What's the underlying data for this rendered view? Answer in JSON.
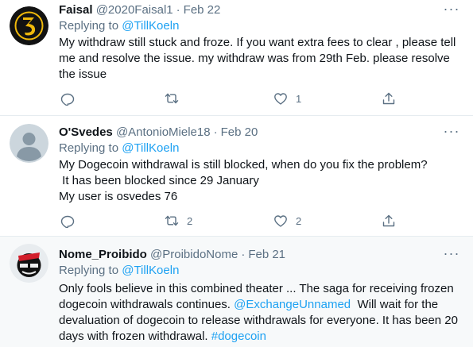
{
  "tweets": [
    {
      "name": "Faisal",
      "handle": "@2020Faisal1",
      "date": "Feb 22",
      "replying_prefix": "Replying to ",
      "replying_to": "@TillKoeln",
      "lines": [
        "My withdraw still stuck and froze. If you want extra fees to clear , please tell",
        "me and resolve the issue. my withdraw was from 29th Feb. please resolve",
        "the issue"
      ],
      "reply_count": "",
      "retweet_count": "",
      "like_count": "1"
    },
    {
      "name": "O'Svedes",
      "handle": "@AntonioMiele18",
      "date": "Feb 20",
      "replying_prefix": "Replying to ",
      "replying_to": "@TillKoeln",
      "lines": [
        "My Dogecoin withdrawal is still blocked, when do you fix the problem?",
        " It has been blocked since 29 January",
        "My user is osvedes 76"
      ],
      "reply_count": "",
      "retweet_count": "2",
      "like_count": "2"
    },
    {
      "name": "Nome_Proibido",
      "handle": "@ProibidoNome",
      "date": "Feb 21",
      "replying_prefix": "Replying to ",
      "replying_to": "@TillKoeln",
      "line1": "Only fools believe in this combined theater ... The saga for receiving frozen",
      "line2_pre": "dogecoin withdrawals continues. ",
      "line2_mention": "@ExchangeUnnamed",
      "line2_post": "  Will wait for the",
      "line3": "devaluation of dogecoin to release withdrawals for everyone. It has been 20",
      "line4_pre": "days with frozen withdrawal. ",
      "line4_hashtag": "#dogecoin"
    }
  ],
  "separator": "·",
  "more_label": "···",
  "icons": {
    "reply": "reply-icon",
    "retweet": "retweet-icon",
    "like": "like-icon",
    "share": "share-icon",
    "more": "more-icon"
  },
  "colors": {
    "accent": "#1da1f2",
    "secondary_text": "#5b7083",
    "highlight_bg": "#f7f9fa"
  }
}
